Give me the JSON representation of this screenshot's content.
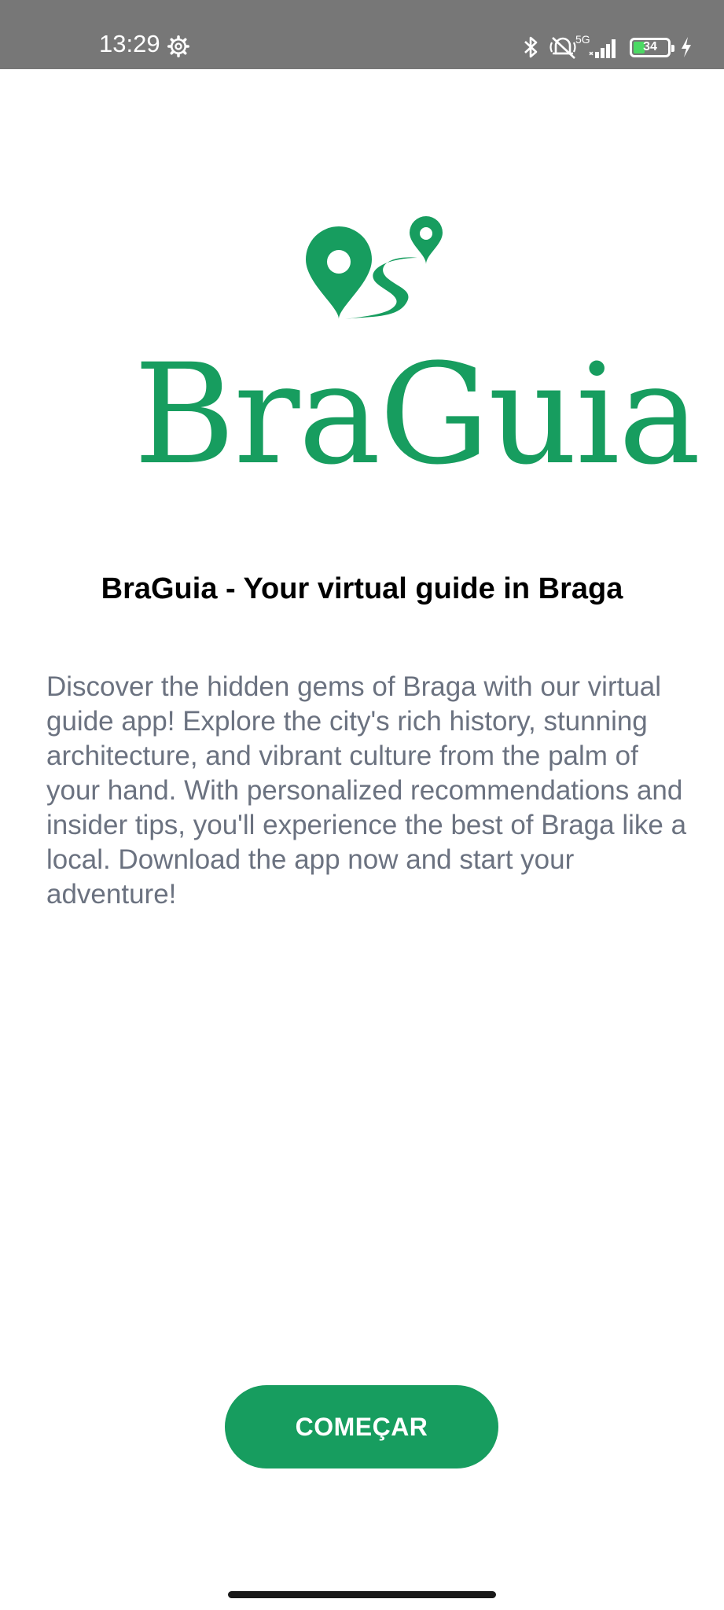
{
  "status_bar": {
    "time": "13:29",
    "network": "5G",
    "battery_level": "34",
    "battery_fraction": 0.34,
    "icons": [
      "gear-icon",
      "bluetooth-icon",
      "mute-icon",
      "signal-icon",
      "battery-icon",
      "charging-icon"
    ]
  },
  "logo": {
    "wordmark": "BraGuia",
    "color": "#179D5F"
  },
  "headline": "BraGuia - Your virtual guide in Braga",
  "description": "Discover the hidden gems of Braga with our virtual guide app! Explore the city's rich history, stunning architecture, and vibrant culture from the palm of your hand. With personalized recommendations and insider tips, you'll experience the best of Braga like a local. Download the app now and start your adventure!",
  "cta": {
    "label": "COMEÇAR",
    "color": "#179D5F"
  }
}
